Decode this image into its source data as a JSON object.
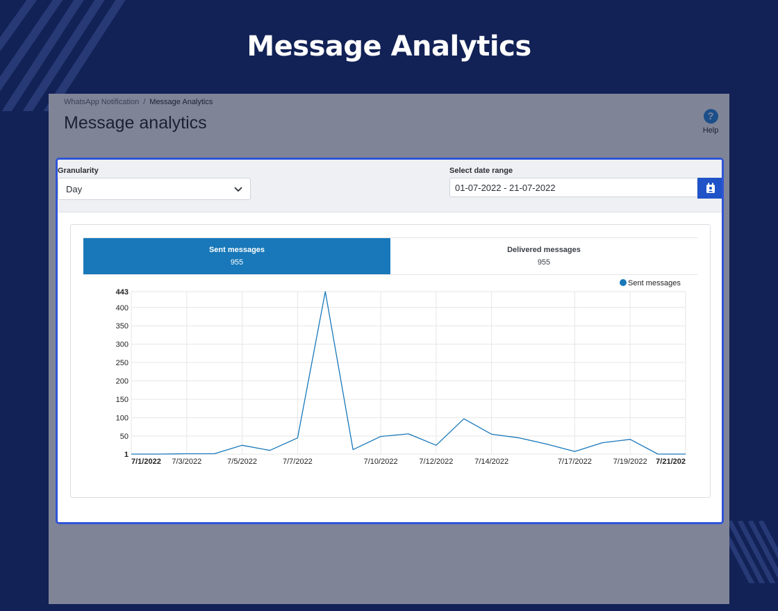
{
  "page": {
    "title": "Message Analytics"
  },
  "breadcrumb": {
    "parent": "WhatsApp Notification",
    "separator": "/",
    "current": "Message Analytics"
  },
  "header": {
    "title": "Message analytics",
    "help_label": "Help",
    "help_icon": "question-circle-icon"
  },
  "filters": {
    "granularity_label": "Granularity",
    "granularity_value": "Day",
    "date_label": "Select date range",
    "date_value": "01-07-2022 - 21-07-2022",
    "calendar_icon": "calendar-user-icon"
  },
  "tabs": [
    {
      "label": "Sent messages",
      "count": "955",
      "active": true
    },
    {
      "label": "Delivered messages",
      "count": "955",
      "active": false
    }
  ],
  "colors": {
    "accent": "#1878b9",
    "panel_border": "#2f54d8",
    "background": "#122256",
    "button": "#1f53c7"
  },
  "chart_data": {
    "type": "line",
    "legend": "top-right",
    "grid": true,
    "x_ticks": [
      "7/1/2022",
      "7/3/2022",
      "7/5/2022",
      "7/7/2022",
      "7/10/2022",
      "7/12/2022",
      "7/14/2022",
      "7/17/2022",
      "7/19/2022",
      "7/21/202"
    ],
    "y_ticks": [
      "1",
      "50",
      "100",
      "150",
      "200",
      "250",
      "300",
      "350",
      "400",
      "443"
    ],
    "ylim": [
      1,
      443
    ],
    "series": [
      {
        "name": "Sent messages",
        "color": "#1878b9",
        "x": [
          "7/1/2022",
          "7/2/2022",
          "7/3/2022",
          "7/4/2022",
          "7/5/2022",
          "7/6/2022",
          "7/7/2022",
          "7/8/2022",
          "7/9/2022",
          "7/10/2022",
          "7/11/2022",
          "7/12/2022",
          "7/13/2022",
          "7/14/2022",
          "7/15/2022",
          "7/16/2022",
          "7/17/2022",
          "7/18/2022",
          "7/19/2022",
          "7/20/2022",
          "7/21/2022"
        ],
        "values": [
          1,
          1,
          2,
          2,
          25,
          11,
          45,
          443,
          13,
          49,
          56,
          25,
          97,
          55,
          45,
          28,
          8,
          32,
          41,
          1,
          1
        ]
      }
    ]
  }
}
